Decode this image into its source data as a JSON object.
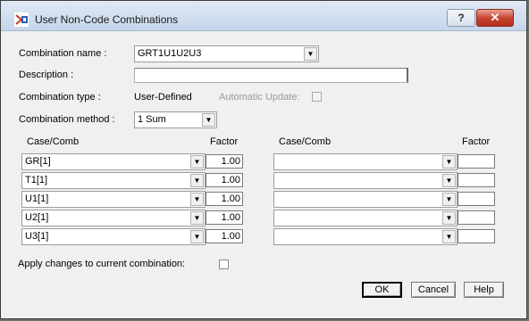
{
  "window": {
    "title": "User Non-Code Combinations"
  },
  "titlebar": {
    "help_label": "?",
    "close_label": "✕"
  },
  "form": {
    "combination_name_label": "Combination name :",
    "combination_name_value": "GRT1U1U2U3",
    "description_label": "Description :",
    "description_value": "",
    "combination_type_label": "Combination type :",
    "combination_type_value": "User-Defined",
    "automatic_update_label": "Automatic Update:",
    "automatic_update_checked": false,
    "combination_method_label": "Combination method :",
    "combination_method_value": "1 Sum"
  },
  "grid": {
    "case_header_left": "Case/Comb",
    "factor_header_left": "Factor",
    "case_header_right": "Case/Comb",
    "factor_header_right": "Factor",
    "left_rows": [
      {
        "case": "GR[1]",
        "factor": "1.00"
      },
      {
        "case": "T1[1]",
        "factor": "1.00"
      },
      {
        "case": "U1[1]",
        "factor": "1.00"
      },
      {
        "case": "U2[1]",
        "factor": "1.00"
      },
      {
        "case": "U3[1]",
        "factor": "1.00"
      }
    ],
    "right_rows": [
      {
        "case": "",
        "factor": ""
      },
      {
        "case": "",
        "factor": ""
      },
      {
        "case": "",
        "factor": ""
      },
      {
        "case": "",
        "factor": ""
      },
      {
        "case": "",
        "factor": ""
      }
    ]
  },
  "apply_changes_label": "Apply changes to current combination:",
  "buttons": {
    "ok": "OK",
    "cancel": "Cancel",
    "help": "Help"
  },
  "icons": {
    "dropdown": "▼"
  }
}
